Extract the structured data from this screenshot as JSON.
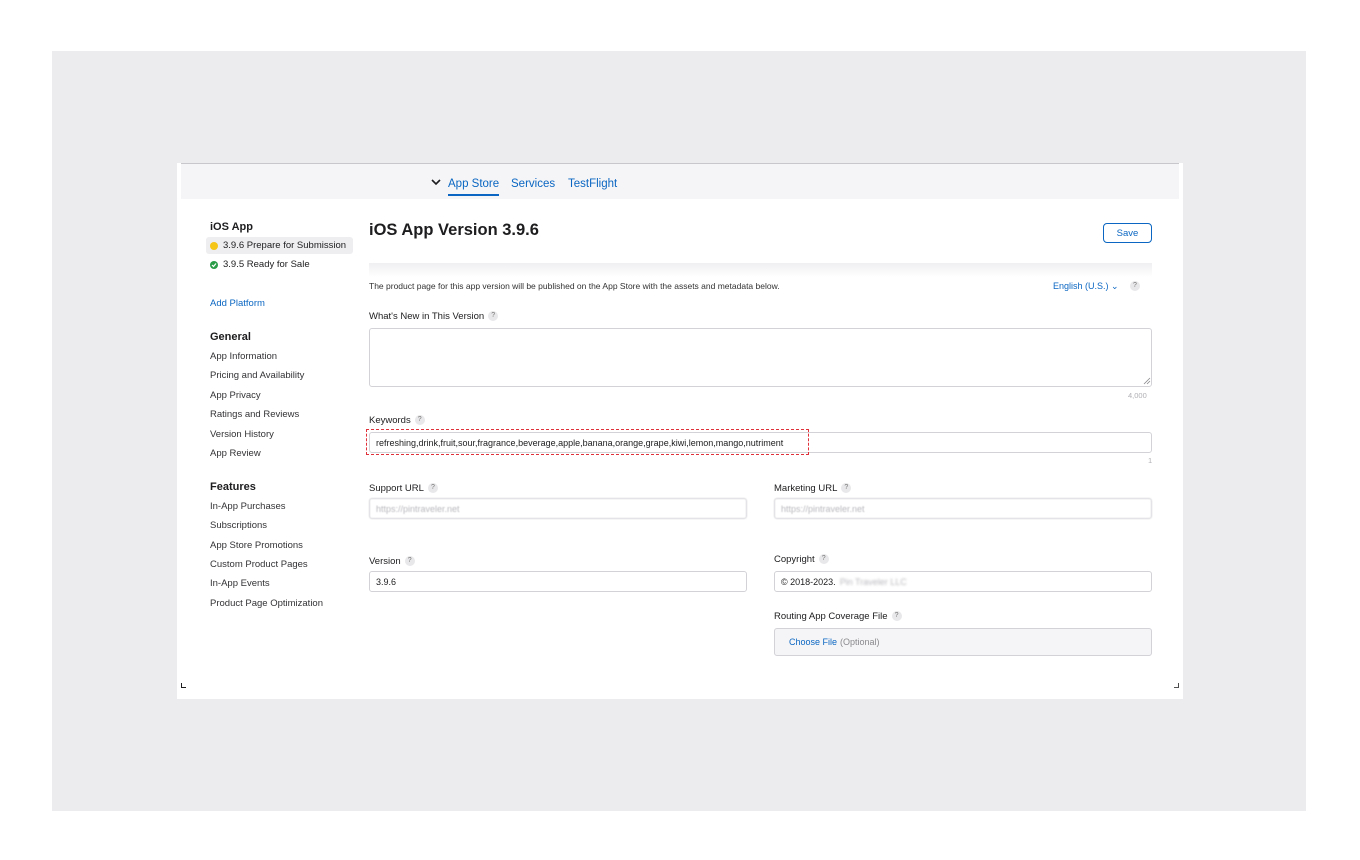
{
  "colors": {
    "accent": "#0a66c2",
    "highlight": "#e0303a",
    "pending": "#f5c518",
    "ready": "#2a9c48"
  },
  "nav": {
    "tabs": [
      {
        "label": "App Store",
        "active": true
      },
      {
        "label": "Services",
        "active": false
      },
      {
        "label": "TestFlight",
        "active": false
      }
    ]
  },
  "sidebar": {
    "title": "iOS App",
    "versions": [
      {
        "label": "3.9.6 Prepare for Submission",
        "status": "yellow"
      },
      {
        "label": "3.9.5 Ready for Sale",
        "status": "green"
      }
    ],
    "add_platform": "Add Platform",
    "general": {
      "heading": "General",
      "items": [
        "App Information",
        "Pricing and Availability",
        "App Privacy",
        "Ratings and Reviews",
        "Version History",
        "App Review"
      ]
    },
    "features": {
      "heading": "Features",
      "items": [
        "In-App Purchases",
        "Subscriptions",
        "App Store Promotions",
        "Custom Product Pages",
        "In-App Events",
        "Product Page Optimization"
      ]
    }
  },
  "main": {
    "title": "iOS App Version 3.9.6",
    "save_label": "Save",
    "description": "The product page for this app version will be published on the App Store with the assets and metadata below.",
    "language": "English (U.S.)",
    "whats_new": {
      "label": "What's New in This Version",
      "value": "",
      "count": "4,000"
    },
    "keywords": {
      "label": "Keywords",
      "value": "refreshing,drink,fruit,sour,fragrance,beverage,apple,banana,orange,grape,kiwi,lemon,mango,nutriment",
      "count": "1"
    },
    "support_url": {
      "label": "Support URL",
      "value": "https://pintraveler.net"
    },
    "marketing_url": {
      "label": "Marketing URL",
      "value": "https://pintraveler.net"
    },
    "version": {
      "label": "Version",
      "value": "3.9.6"
    },
    "copyright": {
      "label": "Copyright",
      "value": "© 2018-2023.",
      "blurred_part": "Pin Traveler LLC"
    },
    "routing": {
      "label": "Routing App Coverage File",
      "choose": "Choose File",
      "optional": "(Optional)"
    }
  }
}
